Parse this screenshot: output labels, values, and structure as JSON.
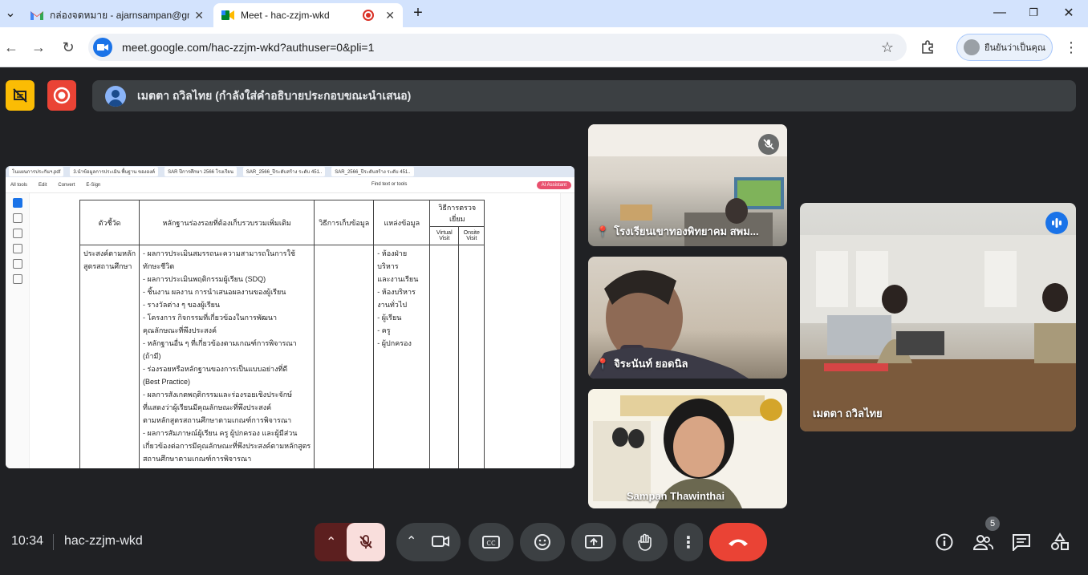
{
  "browser": {
    "tabs": [
      {
        "title": "กล่องจดหมาย - ajarnsampan@gm",
        "active": false
      },
      {
        "title": "Meet - hac-zzjm-wkd",
        "active": true
      }
    ],
    "url": "meet.google.com/hac-zzjm-wkd?authuser=0&pli=1",
    "profile_label": "ยืนยันว่าเป็นคุณ"
  },
  "meet": {
    "presenter_text": "เมตตา ถวิลไทย (กำลังใส่คำอธิบายประกอบขณะนำเสนอ)",
    "time": "10:34",
    "meeting_code": "hac-zzjm-wkd",
    "participant_count": "5",
    "tiles": [
      {
        "name": "โรงเรียนเขาทองพิทยาคม สพม..."
      },
      {
        "name": "จิระนันท์ ยอดนิล"
      },
      {
        "name": "Sampan Thawinthai"
      },
      {
        "name": "เมตตา ถวิลไทย"
      }
    ]
  },
  "shared_doc": {
    "tabs": [
      "โนแผนการประกันฯ.pdf",
      "3.นำข้อมูลการประเมิน พื้นฐาน ขององค์",
      "SAR ปีการศึกษา 2566 โรงเรียน",
      "SAR_2566_ปีระดับสร้าง ระดับ 451..",
      "SAR_2566_ปีระดับสร้าง ระดับ 451.."
    ],
    "menu": [
      "All tools",
      "Edit",
      "Convert",
      "E-Sign"
    ],
    "find_label": "Find text or tools",
    "ai_label": "AI Assistant",
    "headers": {
      "indicator": "ตัวชี้วัด",
      "evidence": "หลักฐานร่องรอยที่ต้องเก็บรวบรวมเพิ่มเติม",
      "method": "วิธีการเก็บข้อมูล",
      "source": "แหล่งข้อมูล",
      "visit": "วิธีการตรวจเยี่ยม",
      "virtual": "Virtual Visit",
      "onsite": "Onsite Visit"
    },
    "indicator_text": [
      "ประสงค์ตามหลัก",
      "สูตรสถานศึกษา"
    ],
    "evidence_lines": [
      "- ผลการประเมินสมรรถนะความสามารถในการใช้",
      "ทักษะชีวิต",
      "- ผลการประเมินพฤติกรรมผู้เรียน (SDQ)",
      "- ชิ้นงาน ผลงาน การนำเสนอผลงานของผู้เรียน",
      "- รางวัลต่าง ๆ ของผู้เรียน",
      "- โครงการ กิจกรรมที่เกี่ยวข้องในการพัฒนา",
      "คุณลักษณะที่พึงประสงค์",
      "- หลักฐานอื่น ๆ ที่เกี่ยวข้องตามเกณฑ์การพิจารณา",
      "(ถ้ามี)",
      "- ร่องรอยหรือหลักฐานของการเป็นแบบอย่างที่ดี",
      "(Best Practice)",
      "- ผลการสังเกตพฤติกรรมและร่องรอยเชิงประจักษ์",
      "ที่แสดงว่าผู้เรียนมีคุณลักษณะที่พึงประสงค์",
      "ตามหลักสูตรสถานศึกษาตามเกณฑ์การพิจารณา",
      "- ผลการสัมภาษณ์ผู้เรียน ครู ผู้ปกครอง และผู้มีส่วน",
      "เกี่ยวข้องต่อการมีคุณลักษณะที่พึงประสงค์ตามหลักสูตร",
      "สถานศึกษาตามเกณฑ์การพิจารณา"
    ],
    "source_lines": [
      "- ห้องฝ่าย",
      "บริหาร",
      "และงานเรียน",
      "- ห้องบริหาร",
      "งานทั่วไป",
      "- ผู้เรียน",
      "- ครู",
      "- ผู้ปกครอง"
    ]
  },
  "colors": {
    "meet_bg": "#202124",
    "end_call": "#ea4335",
    "mic_off": "#f9dedc",
    "accent": "#1a73e8"
  }
}
